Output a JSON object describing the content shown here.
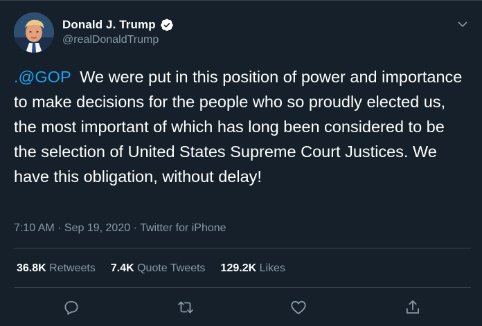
{
  "user": {
    "display_name": "Donald J. Trump",
    "handle": "@realDonaldTrump",
    "verified": true,
    "avatar_icon": "profile-photo"
  },
  "tweet": {
    "mention": ".@GOP",
    "body": "  We were put in this position of power and importance to make decisions for the people who so proudly elected us, the most important of which has long been considered to be the selection of United States Supreme Court Justices. We have this obligation, without delay!",
    "time": "7:10 AM",
    "separator": " · ",
    "date": "Sep 19, 2020",
    "source": "Twitter for iPhone"
  },
  "stats": {
    "retweets_count": "36.8K",
    "retweets_label": "Retweets",
    "quotes_count": "7.4K",
    "quotes_label": "Quote Tweets",
    "likes_count": "129.2K",
    "likes_label": "Likes"
  },
  "actions": {
    "reply_icon": "reply-icon",
    "retweet_icon": "retweet-icon",
    "like_icon": "heart-icon",
    "share_icon": "share-icon"
  },
  "colors": {
    "background": "#15202b",
    "text": "#ffffff",
    "secondary": "#8899a6",
    "link": "#1da1f2",
    "divider": "#38444d"
  }
}
